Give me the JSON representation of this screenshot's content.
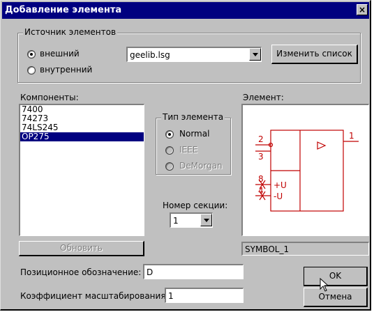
{
  "window": {
    "title": "Добавление элемента",
    "close": "×"
  },
  "source": {
    "label": "Источник элементов",
    "external": "внешний",
    "internal": "внутренний",
    "library": "geelib.lsg",
    "change_list": "Изменить список"
  },
  "components": {
    "label": "Компоненты:",
    "items": [
      "7400",
      "74273",
      "74LS245",
      "OP275"
    ],
    "selected": "OP275"
  },
  "element_type": {
    "label": "Тип элемента",
    "normal": "Normal",
    "ieee": "IEEE",
    "demorgan": "DeMorgan"
  },
  "section": {
    "label": "Номер секции:",
    "value": "1"
  },
  "preview": {
    "label": "Элемент:",
    "symbol_name": "SYMBOL_1",
    "pins": {
      "p1": "1",
      "p2": "2",
      "p3": "3",
      "p8": "8",
      "p4": "4",
      "plus": "+U",
      "minus": "-U"
    }
  },
  "update_button": "Обновить",
  "designator": {
    "label": "Позиционное обозначение:",
    "value": "D"
  },
  "scale": {
    "label": "Коэффициент масштабирования:",
    "value": "1"
  },
  "ok_button": "OK",
  "cancel_button": "Отмена",
  "colors": {
    "titlebar": "#000080",
    "face": "#c0c0c0",
    "symbol": "#c00000"
  }
}
